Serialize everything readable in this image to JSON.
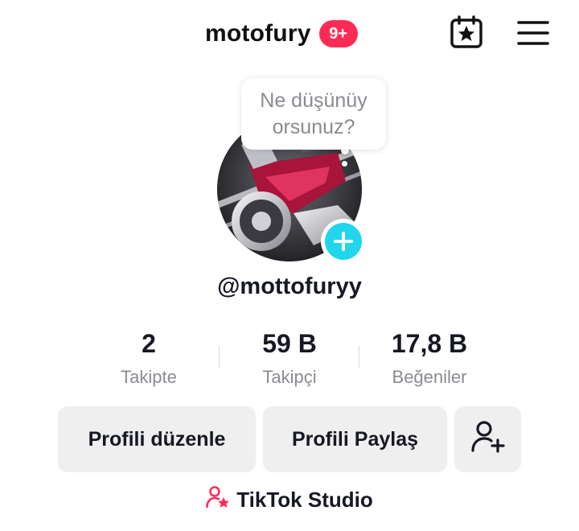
{
  "header": {
    "brand": "motofury",
    "notification_badge": "9+",
    "calendar_icon": "calendar-star-icon",
    "menu_icon": "hamburger-menu-icon"
  },
  "bubble": {
    "text": "Ne düşünüy orsunuz?"
  },
  "profile": {
    "username": "@mottofuryy",
    "add_icon": "plus-icon"
  },
  "stats": [
    {
      "value": "2",
      "label": "Takipte"
    },
    {
      "value": "59 B",
      "label": "Takipçi"
    },
    {
      "value": "17,8 B",
      "label": "Beğeniler"
    }
  ],
  "actions": {
    "edit_profile": "Profili düzenle",
    "share_profile": "Profili Paylaş",
    "add_friend_icon": "add-user-icon"
  },
  "studio": {
    "label": "TikTok Studio",
    "icon": "user-star-icon"
  },
  "colors": {
    "badge": "#fe2c55",
    "add_button": "#20d5ec",
    "button_bg": "#efeff0",
    "muted_text": "#8a8b91"
  }
}
